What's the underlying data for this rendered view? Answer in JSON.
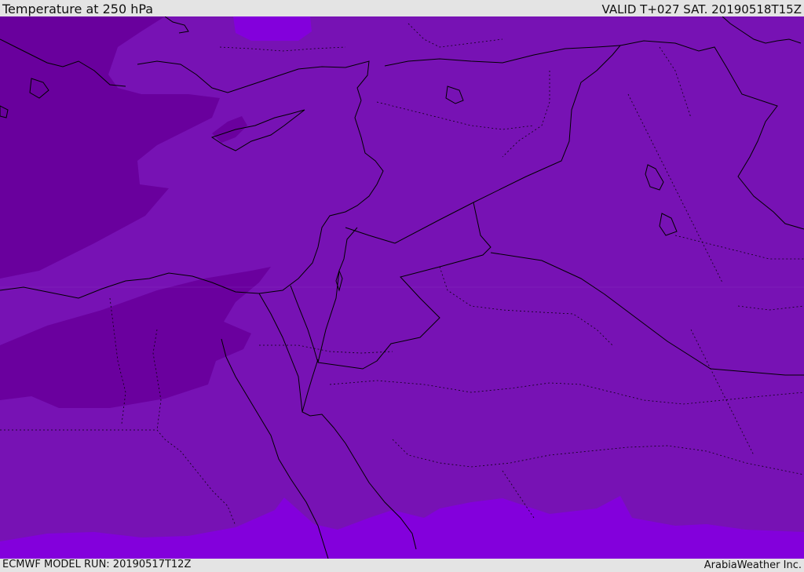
{
  "header": {
    "title": "Temperature at 250 hPa",
    "valid": "VALID T+027 SAT. 20190518T15Z"
  },
  "footer": {
    "model_run": "ECMWF MODEL RUN: 20190517T12Z",
    "credit": "ArabiaWeather Inc."
  },
  "map_colors": {
    "background": "#7712b4",
    "cold_band": "#6a009e",
    "mid_band": "#7a11b8",
    "warm_band": "#8300dc",
    "coastline": "#000000",
    "border": "#000000"
  }
}
